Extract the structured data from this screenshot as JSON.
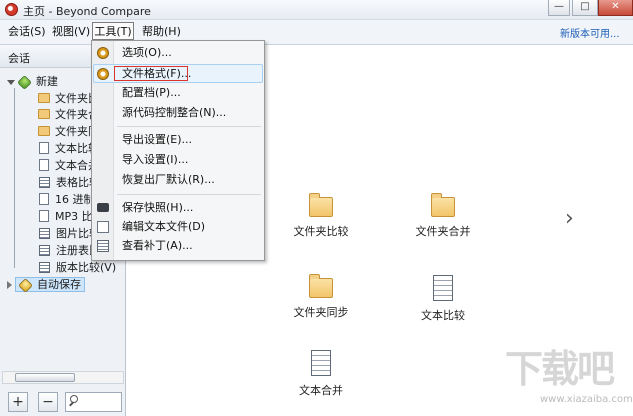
{
  "window": {
    "title": "主页 - Beyond Compare",
    "buttons": {
      "minimize": "—",
      "maximize": "□",
      "close": "✕"
    }
  },
  "menubar": {
    "items": [
      "会话(S)",
      "视图(V)",
      "工具(T)",
      "帮助(H)"
    ],
    "new_version_link": "新版本可用..."
  },
  "sidebar": {
    "header": "会话",
    "new_group": "新建",
    "items": [
      "文件夹比",
      "文件夹合",
      "文件夹同",
      "文本比较",
      "文本合并",
      "表格比较",
      "16 进制",
      "MP3 比",
      "图片比较",
      "注册表比",
      "版本比较(V)"
    ],
    "auto_save": "自动保存",
    "add_button": "+",
    "remove_button": "−"
  },
  "tools_menu": {
    "items": [
      {
        "label": "选项(O)...",
        "icon": "gear-icon"
      },
      {
        "label": "文件格式(F)...",
        "icon": "file-format-icon",
        "highlighted": true
      },
      {
        "label": "配置档(P)...",
        "icon": ""
      },
      {
        "label": "源代码控制整合(N)...",
        "icon": ""
      },
      {
        "label": "导出设置(E)...",
        "icon": ""
      },
      {
        "label": "导入设置(I)...",
        "icon": ""
      },
      {
        "label": "恢复出厂默认(R)...",
        "icon": ""
      },
      {
        "label": "保存快照(H)...",
        "icon": "camera-icon"
      },
      {
        "label": "编辑文本文件(D)",
        "icon": "edit-icon"
      },
      {
        "label": "查看补丁(A)...",
        "icon": "patch-icon"
      }
    ]
  },
  "main": {
    "tiles": [
      "文件夹比较",
      "文件夹合并",
      "文件夹同步",
      "文本比较",
      "文本合并"
    ],
    "next_arrow": "›"
  },
  "watermark": {
    "text": "下载吧",
    "url": "www.xiazaiba.com"
  },
  "colors": {
    "highlight_border": "#d8342b",
    "link": "#1c5eb8",
    "hover_bg": "#e9f3fc"
  }
}
